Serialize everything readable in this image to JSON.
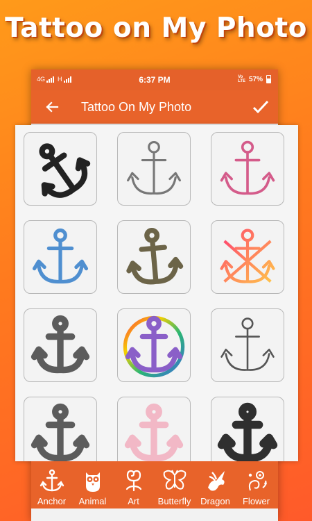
{
  "promo": {
    "title": "Tattoo on My Photo"
  },
  "status": {
    "network": "4G",
    "signal2": "H",
    "time": "6:37 PM",
    "lte": "Vo\nLTE",
    "battery": "57%"
  },
  "appbar": {
    "title": "Tattoo On My Photo"
  },
  "tiles": [
    {
      "name": "anchor-tile-1",
      "style": "solid-tilted"
    },
    {
      "name": "anchor-tile-2",
      "style": "sketch"
    },
    {
      "name": "anchor-tile-3",
      "style": "pink-outline"
    },
    {
      "name": "anchor-tile-4",
      "style": "blue-outline"
    },
    {
      "name": "anchor-tile-5",
      "style": "olive"
    },
    {
      "name": "anchor-tile-6",
      "style": "gradient-crossed"
    },
    {
      "name": "anchor-tile-7",
      "style": "gray-solid"
    },
    {
      "name": "anchor-tile-8",
      "style": "rainbow-circle"
    },
    {
      "name": "anchor-tile-9",
      "style": "outline"
    },
    {
      "name": "anchor-tile-10",
      "style": "gray-solid"
    },
    {
      "name": "anchor-tile-11",
      "style": "pink-faded"
    },
    {
      "name": "anchor-tile-12",
      "style": "dark-solid"
    }
  ],
  "categories": [
    {
      "label": "Anchor",
      "icon": "anchor-icon"
    },
    {
      "label": "Animal",
      "icon": "owl-icon"
    },
    {
      "label": "Art",
      "icon": "swirl-icon"
    },
    {
      "label": "Butterfly",
      "icon": "butterfly-icon"
    },
    {
      "label": "Dragon",
      "icon": "dragon-icon"
    },
    {
      "label": "Flower",
      "icon": "flower-icon"
    }
  ]
}
